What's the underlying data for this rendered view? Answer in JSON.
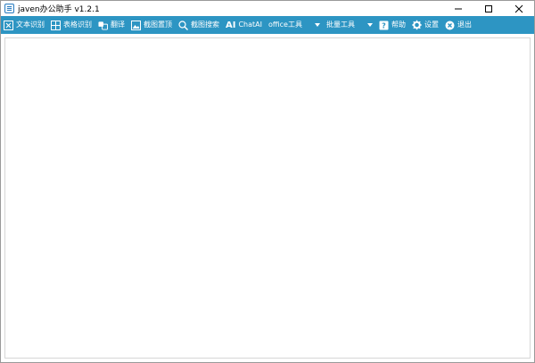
{
  "window": {
    "title": "javen办公助手 v1.2.1"
  },
  "toolbar": {
    "items": [
      {
        "label": "文本识别",
        "icon": "text-recognition-icon"
      },
      {
        "label": "表格识别",
        "icon": "table-recognition-icon"
      },
      {
        "label": "翻译",
        "icon": "translate-icon"
      },
      {
        "label": "截图置顶",
        "icon": "screenshot-pin-icon"
      },
      {
        "label": "截图搜索",
        "icon": "search-icon"
      },
      {
        "label": "ChatAI",
        "icon": "ai-icon",
        "icon_text": "AI"
      },
      {
        "label": "office工具",
        "icon": "chevron-down-icon"
      },
      {
        "label": "批量工具",
        "icon": "chevron-down-icon"
      },
      {
        "label": "帮助",
        "icon": "help-icon"
      },
      {
        "label": "设置",
        "icon": "gear-icon"
      },
      {
        "label": "退出",
        "icon": "close-circle-icon"
      }
    ]
  },
  "colors": {
    "toolbar_bg": "#2d95c3",
    "toolbar_text": "#ffffff"
  }
}
